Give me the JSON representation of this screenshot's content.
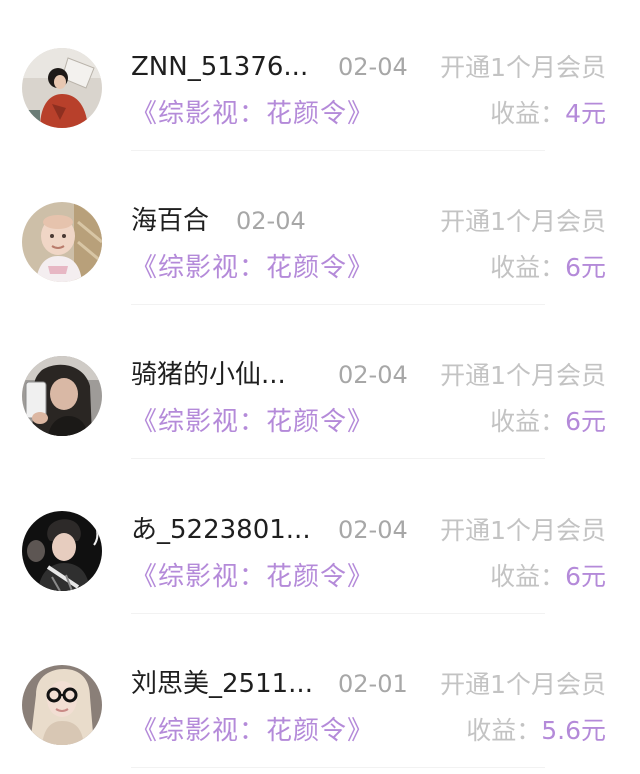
{
  "records": [
    {
      "name": "ZNN_51376...",
      "date": "02-04",
      "action": "开通1个月会员",
      "series": "《综影视：花颜令》",
      "earn_label": "收益：",
      "earn_value": "4元"
    },
    {
      "name": "海百合",
      "date": "02-04",
      "action": "开通1个月会员",
      "series": "《综影视：花颜令》",
      "earn_label": "收益：",
      "earn_value": "6元"
    },
    {
      "name": "骑猪的小仙...",
      "date": "02-04",
      "action": "开通1个月会员",
      "series": "《综影视：花颜令》",
      "earn_label": "收益：",
      "earn_value": "6元"
    },
    {
      "name": "あ_5223801...",
      "date": "02-04",
      "action": "开通1个月会员",
      "series": "《综影视：花颜令》",
      "earn_label": "收益：",
      "earn_value": "6元"
    },
    {
      "name": "刘思美_2511...",
      "date": "02-01",
      "action": "开通1个月会员",
      "series": "《综影视：花颜令》",
      "earn_label": "收益：",
      "earn_value": "5.6元"
    }
  ],
  "colors": {
    "accent": "#b48ad9",
    "muted": "#c3c3c3",
    "date": "#a7a7a7",
    "name": "#1f1f1f"
  }
}
